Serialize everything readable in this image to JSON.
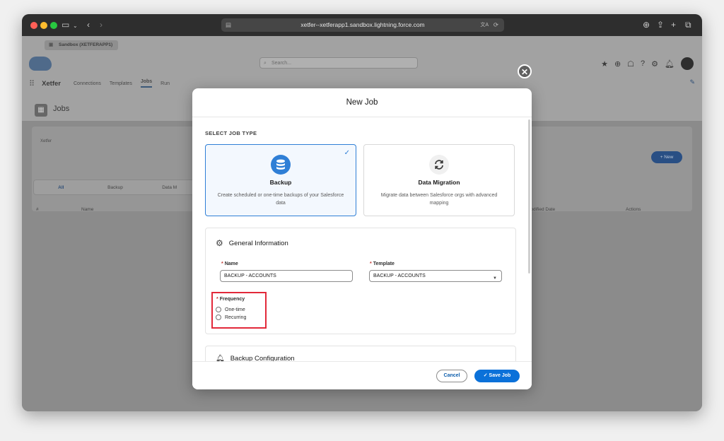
{
  "browser": {
    "url": "xetfer--xetferapp1.sandbox.lightning.force.com"
  },
  "app": {
    "sandbox_label": "Sandbox (XETFERAPP1)",
    "search_placeholder": "Search...",
    "app_name": "Xetfer",
    "tabs": [
      {
        "label": "Connections"
      },
      {
        "label": "Templates"
      },
      {
        "label": "Jobs"
      },
      {
        "label": "Run"
      }
    ],
    "page_title": "Jobs",
    "list_owner": "Xetfer",
    "new_button": "+ New",
    "filters": [
      "All",
      "Backup",
      "Data M"
    ],
    "columns": [
      "#",
      "Name",
      "Modified Date",
      "Actions"
    ]
  },
  "modal": {
    "title": "New Job",
    "section_label": "SELECT JOB TYPE",
    "job_types": [
      {
        "title": "Backup",
        "description": "Create scheduled or one-time backups of your Salesforce data",
        "icon": "database-icon",
        "selected": true
      },
      {
        "title": "Data Migration",
        "description": "Migrate data between Salesforce orgs with advanced mapping",
        "icon": "sync-icon",
        "selected": false
      }
    ],
    "general": {
      "title": "General Information",
      "name_label": "Name",
      "name_value": "BACKUP - ACCOUNTS",
      "template_label": "Template",
      "template_value": "BACKUP - ACCOUNTS",
      "frequency_label": "Frequency",
      "frequency_options": [
        "One-time",
        "Recurring"
      ]
    },
    "backup_config_title": "Backup Configuration",
    "cancel_label": "Cancel",
    "save_label": "Save Job"
  },
  "colors": {
    "brand_blue": "#0b71d9",
    "highlight_red": "#e2293a"
  }
}
